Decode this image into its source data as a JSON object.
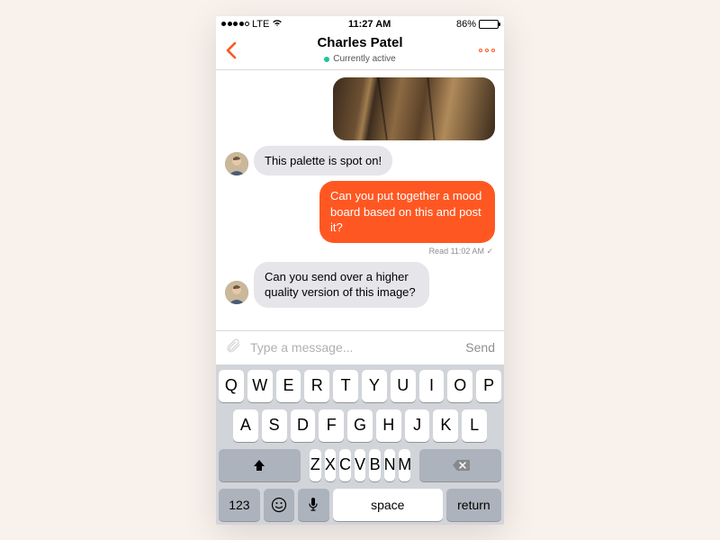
{
  "status": {
    "carrier": "LTE",
    "time": "11:27 AM",
    "battery_pct": "86%"
  },
  "header": {
    "title": "Charles Patel",
    "subtitle": "Currently active"
  },
  "messages": {
    "m1_text": "This palette is spot on!",
    "m2_text": "Can you put together a mood board based on this and post it?",
    "m3_text": "Can you send over a higher quality version of this image?",
    "read_receipt": "Read 11:02 AM"
  },
  "composer": {
    "placeholder": "Type a message...",
    "send_label": "Send"
  },
  "keyboard": {
    "row1": [
      "Q",
      "W",
      "E",
      "R",
      "T",
      "Y",
      "U",
      "I",
      "O",
      "P"
    ],
    "row2": [
      "A",
      "S",
      "D",
      "F",
      "G",
      "H",
      "J",
      "K",
      "L"
    ],
    "row3": [
      "Z",
      "X",
      "C",
      "V",
      "B",
      "N",
      "M"
    ],
    "numKey": "123",
    "space": "space",
    "return": "return"
  }
}
